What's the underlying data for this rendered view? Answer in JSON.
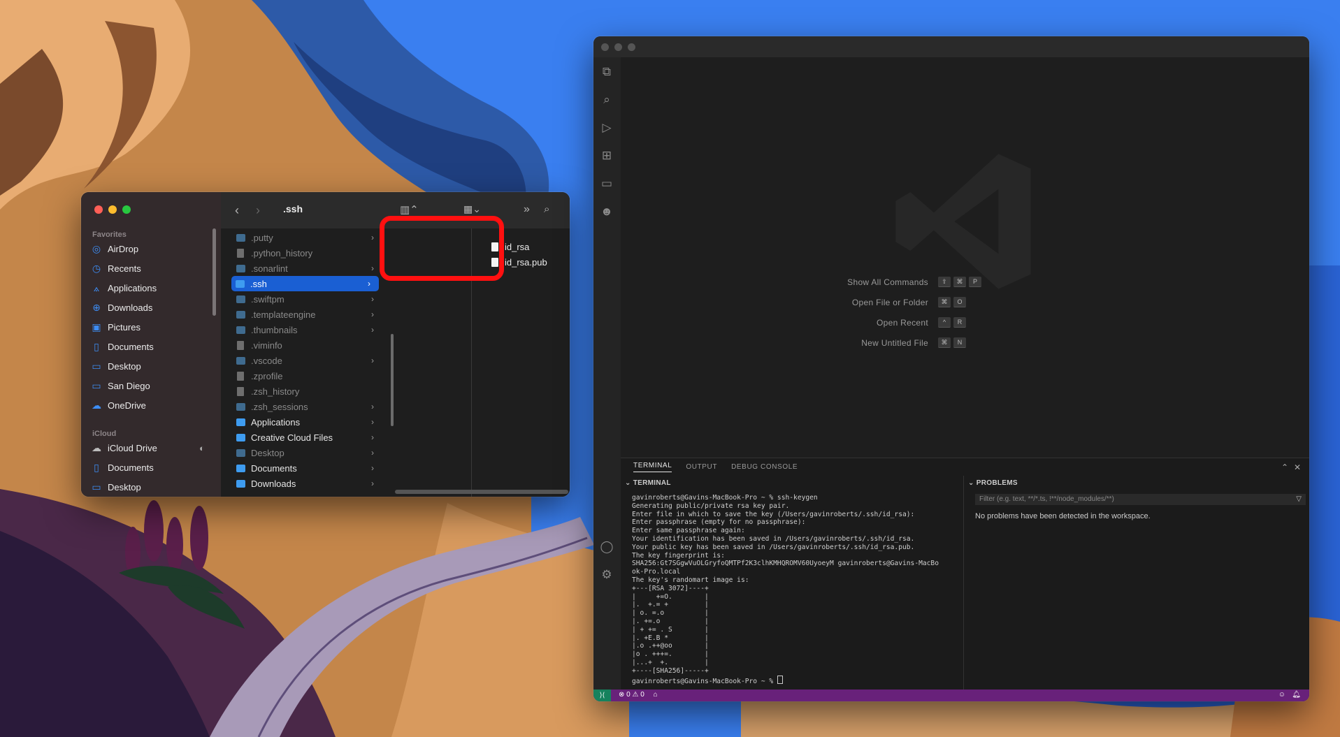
{
  "colors": {
    "sky": "#3a7ff0",
    "finder_selection": "#1a5fd3",
    "highlight_box": "#ff1010",
    "vscode_statusbar": "#68217a",
    "vscode_remote": "#16825d"
  },
  "finder": {
    "title": ".ssh",
    "sidebar": {
      "favorites_header": "Favorites",
      "favorites": [
        {
          "label": "AirDrop",
          "icon": "airdrop-icon"
        },
        {
          "label": "Recents",
          "icon": "clock-icon"
        },
        {
          "label": "Applications",
          "icon": "applications-icon"
        },
        {
          "label": "Downloads",
          "icon": "download-icon"
        },
        {
          "label": "Pictures",
          "icon": "photo-icon"
        },
        {
          "label": "Documents",
          "icon": "document-icon"
        },
        {
          "label": "Desktop",
          "icon": "desktop-icon"
        },
        {
          "label": "San Diego",
          "icon": "folder-icon"
        },
        {
          "label": "OneDrive",
          "icon": "cloud-icon"
        }
      ],
      "icloud_header": "iCloud",
      "icloud": [
        {
          "label": "iCloud Drive",
          "icon": "icloud-icon"
        },
        {
          "label": "Documents",
          "icon": "document-icon"
        },
        {
          "label": "Desktop",
          "icon": "desktop-icon"
        }
      ]
    },
    "column1": [
      {
        "name": ".putty",
        "type": "folder",
        "dim": true,
        "chevron": true
      },
      {
        "name": ".python_history",
        "type": "file",
        "dim": true,
        "chevron": false
      },
      {
        "name": ".sonarlint",
        "type": "folder",
        "dim": true,
        "chevron": true
      },
      {
        "name": ".ssh",
        "type": "folder",
        "dim": false,
        "chevron": true,
        "selected": true
      },
      {
        "name": ".swiftpm",
        "type": "folder",
        "dim": true,
        "chevron": true
      },
      {
        "name": ".templateengine",
        "type": "folder",
        "dim": true,
        "chevron": true
      },
      {
        "name": ".thumbnails",
        "type": "folder",
        "dim": true,
        "chevron": true
      },
      {
        "name": ".viminfo",
        "type": "file",
        "dim": true,
        "chevron": false
      },
      {
        "name": ".vscode",
        "type": "folder",
        "dim": true,
        "chevron": true
      },
      {
        "name": ".zprofile",
        "type": "file",
        "dim": true,
        "chevron": false
      },
      {
        "name": ".zsh_history",
        "type": "file",
        "dim": true,
        "chevron": false
      },
      {
        "name": ".zsh_sessions",
        "type": "folder",
        "dim": true,
        "chevron": true
      },
      {
        "name": "Applications",
        "type": "folder",
        "dim": false,
        "chevron": true
      },
      {
        "name": "Creative Cloud Files",
        "type": "folder",
        "dim": false,
        "chevron": true
      },
      {
        "name": "Desktop",
        "type": "folder",
        "dim": true,
        "chevron": true
      },
      {
        "name": "Documents",
        "type": "folder",
        "dim": false,
        "chevron": true
      },
      {
        "name": "Downloads",
        "type": "folder",
        "dim": false,
        "chevron": true
      }
    ],
    "column2": [
      "id_rsa",
      "id_rsa.pub"
    ]
  },
  "vscode": {
    "welcome": [
      {
        "label": "Show All Commands",
        "keys": [
          "⇧",
          "⌘",
          "P"
        ]
      },
      {
        "label": "Open File or Folder",
        "keys": [
          "⌘",
          "O"
        ]
      },
      {
        "label": "Open Recent",
        "keys": [
          "^",
          "R"
        ]
      },
      {
        "label": "New Untitled File",
        "keys": [
          "⌘",
          "N"
        ]
      }
    ],
    "panel_tabs": [
      "TERMINAL",
      "OUTPUT",
      "DEBUG CONSOLE"
    ],
    "terminal_header": "TERMINAL",
    "problems_header": "PROBLEMS",
    "terminal_lines": [
      "gavinroberts@Gavins-MacBook-Pro ~ % ssh-keygen",
      "Generating public/private rsa key pair.",
      "Enter file in which to save the key (/Users/gavinroberts/.ssh/id_rsa):",
      "Enter passphrase (empty for no passphrase):",
      "Enter same passphrase again:",
      "Your identification has been saved in /Users/gavinroberts/.ssh/id_rsa.",
      "Your public key has been saved in /Users/gavinroberts/.ssh/id_rsa.pub.",
      "The key fingerprint is:",
      "SHA256:Gt7SGgwVuOLGryfoQMTPf2K3clhKMHQROMV60UyoeyM gavinroberts@Gavins-MacBo",
      "ok-Pro.local",
      "The key's randomart image is:",
      "+---[RSA 3072]----+",
      "|     +=O.        |",
      "|.  +.= +         |",
      "| o. =.o          |",
      "|. +=.o           |",
      "| + += . S        |",
      "|. +E.B *         |",
      "|.o .++@oo        |",
      "|o . +++=.        |",
      "|...+  +.         |",
      "+----[SHA256]-----+",
      "gavinroberts@Gavins-MacBook-Pro ~ % "
    ],
    "filter_placeholder": "Filter (e.g. text, **/*.ts, !**/node_modules/**)",
    "no_problems": "No problems have been detected in the workspace.",
    "status_errors": "0",
    "status_warnings": "0"
  }
}
